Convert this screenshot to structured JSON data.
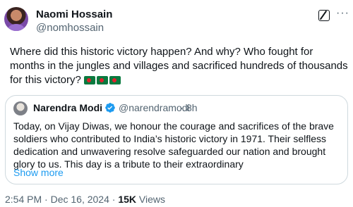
{
  "author": {
    "name": "Naomi Hossain",
    "handle": "@nomhossain"
  },
  "tweet": {
    "text": "Where did this historic victory happen? And why? Who fought for months in the jungles and villages and sacrificed hundreds of thousands for this victory?",
    "flag_emoji": "bangladesh-flag",
    "flag_count": 3
  },
  "quoted": {
    "name": "Narendra Modi",
    "handle": "@narendramodi",
    "separator": "·",
    "time": "8h",
    "text": "Today, on Vijay Diwas, we honour the courage and sacrifices of the brave soldiers who contributed to India’s historic victory in 1971. Their selfless dedication and unwavering resolve safeguarded our nation and brought glory to us. This day is a tribute to their extraordinary",
    "show_more": "Show more",
    "verified_color": "#1d9bf0"
  },
  "footer": {
    "timestamp": "2:54 PM · Dec 16, 2024 · ",
    "views_count": "15K",
    "views_label": " Views"
  },
  "colors": {
    "text": "#0f1419",
    "secondary": "#536471",
    "link": "#1d9bf0",
    "border": "#cfd9de"
  }
}
